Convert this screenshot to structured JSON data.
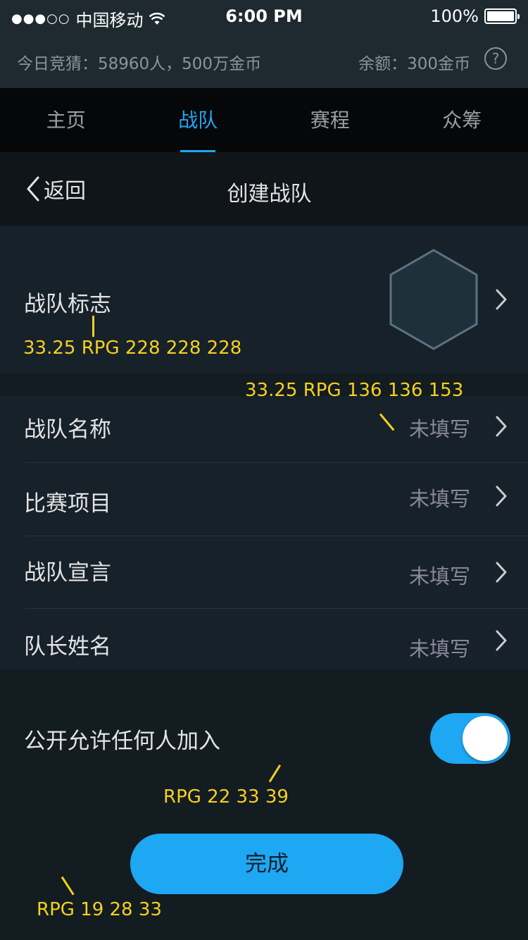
{
  "statusbar": {
    "signal_dots": "●●●○○",
    "carrier": "中国移动",
    "wifi_icon": "wifi-icon",
    "time": "6:00 PM",
    "battery": "100%"
  },
  "infobar": {
    "today": "今日竞猜：58960人，500万金币",
    "balance": "余额：300金币",
    "help_symbol": "?"
  },
  "tabs": [
    {
      "label": "主页",
      "active": false
    },
    {
      "label": "战队",
      "active": true
    },
    {
      "label": "赛程",
      "active": false
    },
    {
      "label": "众筹",
      "active": false
    }
  ],
  "navbar": {
    "back_label": "返回",
    "title": "创建战队"
  },
  "form": {
    "logo_label": "战队标志",
    "fields": [
      {
        "label": "战队名称",
        "value": "未填写"
      },
      {
        "label": "比赛项目",
        "value": "未填写"
      },
      {
        "label": "战队宣言",
        "value": "未填写"
      },
      {
        "label": "队长姓名",
        "value": "未填写"
      }
    ],
    "public_label": "公开允许任何人加入",
    "public_enabled": true
  },
  "actions": {
    "done_label": "完成"
  },
  "annotations": {
    "label_color": "33.25 RPG 228 228 228",
    "value_color": "33.25 RPG 136 136 153",
    "section_bg": "RPG 22 33 39",
    "page_bg": "RPG 19 28 33"
  },
  "colors": {
    "accent": "#1ea7f3",
    "page_bg": "#131c21",
    "section_bg": "#16212a",
    "label_text": "#e4e4e4",
    "value_text": "#888899",
    "annotation": "#f5d020"
  }
}
